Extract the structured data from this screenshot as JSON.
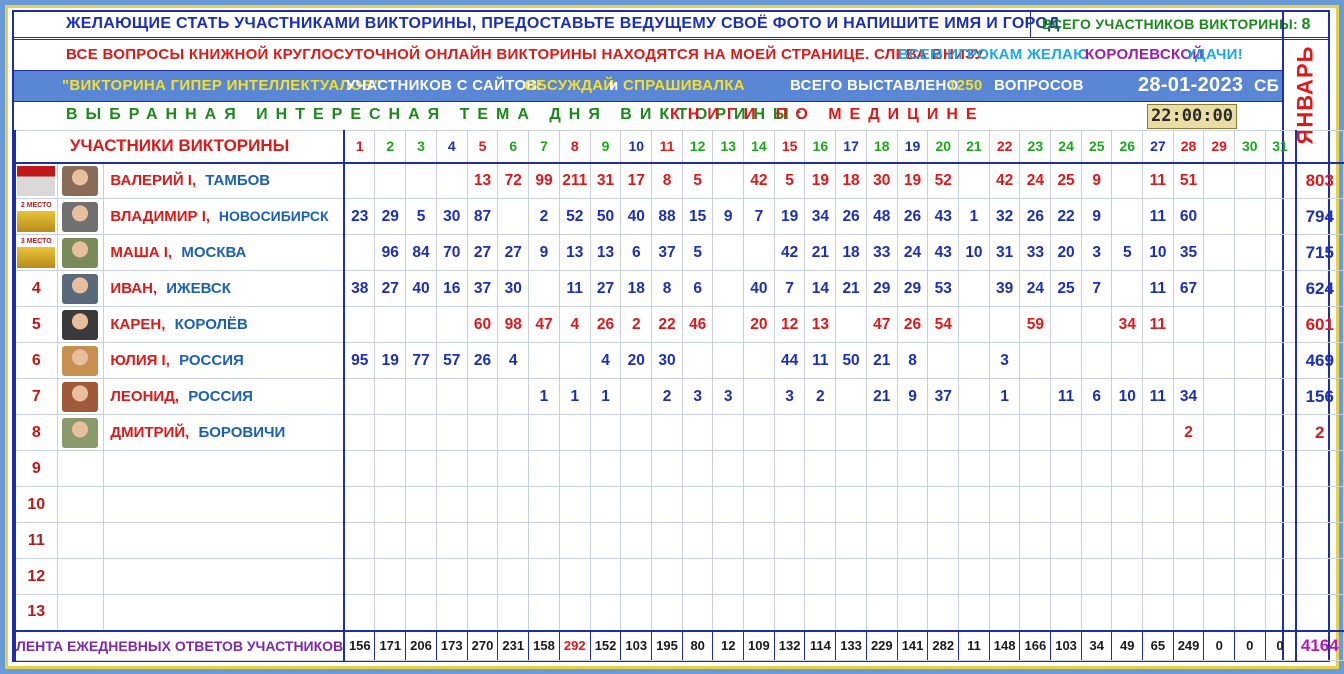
{
  "header": {
    "line1": "ЖЕЛАЮЩИЕ  СТАТЬ  УЧАСТНИКАМИ  ВИКТОРИНЫ,  ПРЕДОСТАВЬТЕ  ВЕДУЩЕМУ  СВОЁ  ФОТО  И  НАПИШИТЕ  ИМЯ И ГОРОД",
    "total_participants_label": "ВСЕГО  УЧАСТНИКОВ  ВИКТОРИНЫ:",
    "total_participants_value": "8",
    "line2_red": "ВСЕ  ВОПРОСЫ  КНИЖНОЙ  КРУГЛОСУТОЧНОЙ  ОНЛАЙН  ВИКТОРИНЫ  НАХОДЯТСЯ  НА  МОЕЙ  СТРАНИЦЕ.  СЛЕВА  ВНИЗУ.",
    "line2_wish_1": "ВСЕМ  ИГРОКАМ  ЖЕЛАЮ",
    "line2_wish_2": "КОРОЛЕВСКОЙ",
    "line2_wish_3": "УДАЧИ!",
    "quiz_name": "\"ВИКТОРИНА ГИПЕР ИНТЕЛЛЕКТУАЛОВ\"",
    "from_sites": "УЧАСТНИКОВ С САЙТОВ:",
    "site1": "ОБСУЖДАЙ",
    "and": "и",
    "site2": "СПРАШИВАЛКА",
    "questions_label": "ВСЕГО ВЫСТАВЛЕНО",
    "questions_value": "1250",
    "questions_unit": "ВОПРОСОВ",
    "date": "28-01-2023",
    "weekday": "СБ",
    "topic_label": "ВЫБРАННАЯ  ИНТЕРЕСНАЯ  ТЕМА  ДНЯ  ВИКТОРИНЫ:",
    "topic_value": "КНИГИ  ПО  МЕДИЦИНЕ",
    "clock": "22:00:00",
    "month": "ЯНВАРЬ"
  },
  "table": {
    "title": "УЧАСТНИКИ ВИКТОРИНЫ",
    "days": [
      "1",
      "2",
      "3",
      "4",
      "5",
      "6",
      "7",
      "8",
      "9",
      "10",
      "11",
      "12",
      "13",
      "14",
      "15",
      "16",
      "17",
      "18",
      "19",
      "20",
      "21",
      "22",
      "23",
      "24",
      "25",
      "26",
      "27",
      "28",
      "29",
      "30",
      "31"
    ],
    "day_colors": [
      "#e01818",
      "#1aa81a",
      "#1aa81a",
      "#1b2fb8",
      "#e01818",
      "#1aa81a",
      "#1aa81a",
      "#e01818",
      "#1aa81a",
      "#1b2fb8",
      "#e01818",
      "#1aa81a",
      "#1aa81a",
      "#1aa81a",
      "#e01818",
      "#1aa81a",
      "#1b2fb8",
      "#1aa81a",
      "#1b2fb8",
      "#1aa81a",
      "#1aa81a",
      "#e01818",
      "#1aa81a",
      "#1aa81a",
      "#1aa81a",
      "#1aa81a",
      "#1b2fb8",
      "#e01818",
      "#e01818",
      "#1aa81a",
      "#1aa81a"
    ],
    "rows": [
      {
        "rank": "",
        "badge": "",
        "name": "ВАЛЕРИЙ І,",
        "city": "ТАМБОВ",
        "color": "red",
        "vals": [
          "",
          "",
          "",
          "",
          "13",
          "72",
          "99",
          "211",
          "31",
          "17",
          "8",
          "5",
          "",
          "42",
          "5",
          "19",
          "18",
          "30",
          "19",
          "52",
          "",
          "42",
          "24",
          "25",
          "9",
          "",
          "11",
          "51",
          "",
          "",
          ""
        ],
        "total": "803"
      },
      {
        "rank": "",
        "badge": "2 МЕСТО",
        "name": "ВЛАДИМИР І,",
        "city": "НОВОСИБИРСК",
        "color": "blue",
        "vals": [
          "23",
          "29",
          "5",
          "30",
          "87",
          "",
          "2",
          "52",
          "50",
          "40",
          "88",
          "15",
          "9",
          "7",
          "19",
          "34",
          "26",
          "48",
          "26",
          "43",
          "1",
          "32",
          "26",
          "22",
          "9",
          "",
          "11",
          "60",
          "",
          "",
          ""
        ],
        "total": "794"
      },
      {
        "rank": "",
        "badge": "3 МЕСТО",
        "name": "МАША І,",
        "city": "МОСКВА",
        "color": "blue",
        "vals": [
          "",
          "96",
          "84",
          "70",
          "27",
          "27",
          "9",
          "13",
          "13",
          "6",
          "37",
          "5",
          "",
          "",
          "42",
          "21",
          "18",
          "33",
          "24",
          "43",
          "10",
          "31",
          "33",
          "20",
          "3",
          "5",
          "10",
          "35",
          "",
          "",
          ""
        ],
        "total": "715"
      },
      {
        "rank": "4",
        "badge": "",
        "name": "ИВАН,",
        "city": "ИЖЕВСК",
        "color": "blue",
        "vals": [
          "38",
          "27",
          "40",
          "16",
          "37",
          "30",
          "",
          "11",
          "27",
          "18",
          "8",
          "6",
          "",
          "40",
          "7",
          "14",
          "21",
          "29",
          "29",
          "53",
          "",
          "39",
          "24",
          "25",
          "7",
          "",
          "11",
          "67",
          "",
          "",
          ""
        ],
        "total": "624"
      },
      {
        "rank": "5",
        "badge": "",
        "name": "КАРЕН,",
        "city": "КОРОЛЁВ",
        "color": "red",
        "vals": [
          "",
          "",
          "",
          "",
          "60",
          "98",
          "47",
          "4",
          "26",
          "2",
          "22",
          "46",
          "",
          "20",
          "12",
          "13",
          "",
          "47",
          "26",
          "54",
          "",
          "",
          "59",
          "",
          "",
          "34",
          "11",
          "",
          "",
          "",
          ""
        ],
        "total": "601"
      },
      {
        "rank": "6",
        "badge": "",
        "name": "ЮЛИЯ І,",
        "city": "РОССИЯ",
        "color": "blue",
        "vals": [
          "95",
          "19",
          "77",
          "57",
          "26",
          "4",
          "",
          "",
          "4",
          "20",
          "30",
          "",
          "",
          "",
          "44",
          "11",
          "50",
          "21",
          "8",
          "",
          "",
          "3",
          "",
          "",
          "",
          "",
          "",
          "",
          "",
          "",
          ""
        ],
        "total": "469"
      },
      {
        "rank": "7",
        "badge": "",
        "name": "ЛЕОНИД,",
        "city": "РОССИЯ",
        "color": "blue",
        "vals": [
          "",
          "",
          "",
          "",
          "",
          "",
          "1",
          "1",
          "1",
          "",
          "2",
          "3",
          "3",
          "",
          "3",
          "2",
          "",
          "21",
          "9",
          "37",
          "",
          "1",
          "",
          "11",
          "6",
          "10",
          "11",
          "34",
          "",
          "",
          ""
        ],
        "total": "156"
      },
      {
        "rank": "8",
        "badge": "",
        "name": "ДМИТРИЙ,",
        "city": "БОРОВИЧИ",
        "color": "red",
        "vals": [
          "",
          "",
          "",
          "",
          "",
          "",
          "",
          "",
          "",
          "",
          "",
          "",
          "",
          "",
          "",
          "",
          "",
          "",
          "",
          "",
          "",
          "",
          "",
          "",
          "",
          "",
          "",
          "2",
          "",
          "",
          ""
        ],
        "total": "2"
      },
      {
        "rank": "9",
        "badge": "",
        "name": "",
        "city": "",
        "color": "blue",
        "vals": [],
        "total": ""
      },
      {
        "rank": "10",
        "badge": "",
        "name": "",
        "city": "",
        "color": "blue",
        "vals": [],
        "total": ""
      },
      {
        "rank": "11",
        "badge": "",
        "name": "",
        "city": "",
        "color": "blue",
        "vals": [],
        "total": ""
      },
      {
        "rank": "12",
        "badge": "",
        "name": "",
        "city": "",
        "color": "blue",
        "vals": [],
        "total": ""
      },
      {
        "rank": "13",
        "badge": "",
        "name": "",
        "city": "",
        "color": "blue",
        "vals": [],
        "total": ""
      }
    ],
    "footer_label": "ЛЕНТА ЕЖЕДНЕВНЫХ ОТВЕТОВ УЧАСТНИКОВ",
    "footer": [
      "156",
      "171",
      "206",
      "173",
      "270",
      "231",
      "158",
      "292",
      "152",
      "103",
      "195",
      "80",
      "12",
      "109",
      "132",
      "114",
      "133",
      "229",
      "141",
      "282",
      "11",
      "148",
      "166",
      "103",
      "34",
      "49",
      "65",
      "249",
      "0",
      "0",
      "0"
    ],
    "footer_highlight_index": 7,
    "grand_total": "4164"
  },
  "colors": {
    "border": "#1e2ea8",
    "frame": "#e6d24a",
    "background": "#6a9ad8",
    "accent_red": "#e01818",
    "accent_blue": "#1b2fb8"
  }
}
